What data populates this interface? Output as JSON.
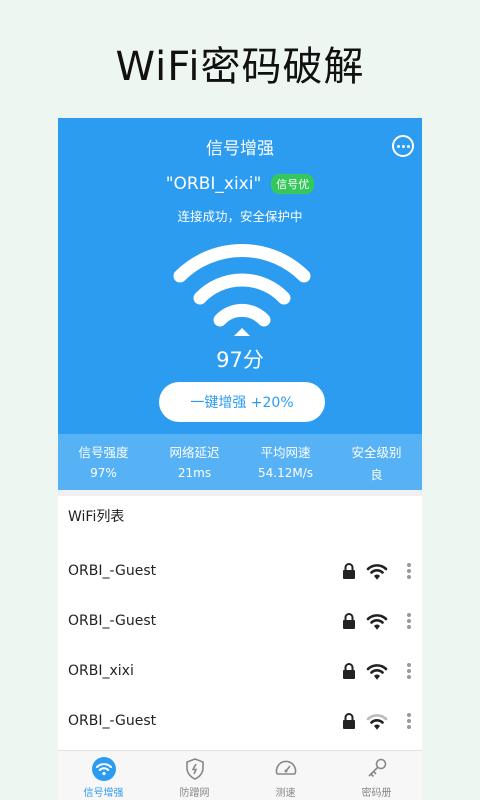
{
  "promo": {
    "title": "WiFi密码破解"
  },
  "header": {
    "title": "信号增强",
    "menu_icon": "chat-dots-icon"
  },
  "connection": {
    "ssid": "\"ORBI_xixi\"",
    "badge": "信号优",
    "status": "连接成功，安全保护中",
    "score": "97分",
    "boost_label": "一键增强 +20%"
  },
  "stats": [
    {
      "label": "信号强度",
      "value": "97%"
    },
    {
      "label": "网络延迟",
      "value": "21ms"
    },
    {
      "label": "平均网速",
      "value": "54.12M/s"
    },
    {
      "label": "安全级别",
      "value": "良"
    }
  ],
  "wifi_list": {
    "title": "WiFi列表",
    "items": [
      {
        "name": "ORBI_-Guest",
        "locked": true,
        "signal": "strong"
      },
      {
        "name": "ORBI_-Guest",
        "locked": true,
        "signal": "strong"
      },
      {
        "name": "ORBI_xixi",
        "locked": true,
        "signal": "strong"
      },
      {
        "name": "ORBI_-Guest",
        "locked": true,
        "signal": "medium"
      }
    ]
  },
  "nav": {
    "items": [
      {
        "label": "信号增强",
        "icon": "wifi-icon",
        "active": true
      },
      {
        "label": "防蹭网",
        "icon": "shield-icon",
        "active": false
      },
      {
        "label": "测速",
        "icon": "speedometer-icon",
        "active": false
      },
      {
        "label": "密码册",
        "icon": "key-icon",
        "active": false
      }
    ]
  },
  "colors": {
    "primary": "#2c9cf1",
    "stats_bg": "#57b2f5",
    "badge": "#34c759",
    "page_bg": "#eef6f1"
  }
}
